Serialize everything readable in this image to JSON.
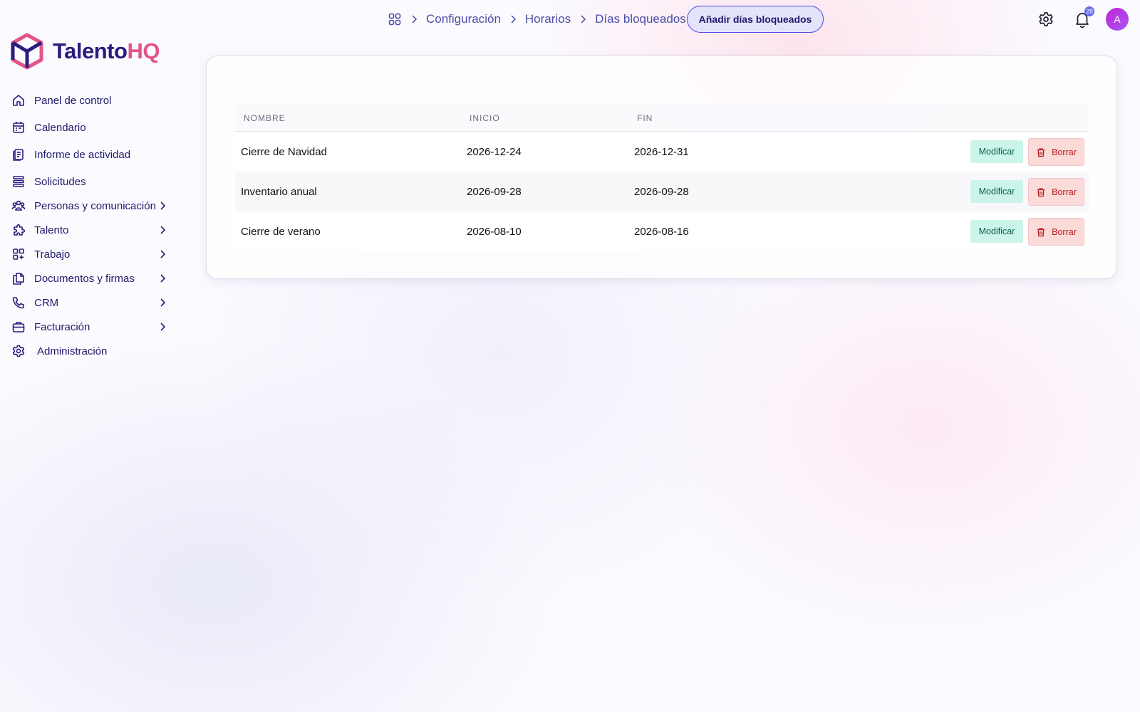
{
  "app": {
    "brand_part1": "Talento",
    "brand_part2": "HQ",
    "accent_color": "#4f46e5",
    "brand_pink": "#e2558a"
  },
  "sidebar": {
    "items": [
      {
        "label": "Panel de control",
        "icon": "home-icon",
        "has_submenu": false
      },
      {
        "label": "Calendario",
        "icon": "calendar-icon",
        "has_submenu": false
      },
      {
        "label": "Informe de actividad",
        "icon": "report-icon",
        "has_submenu": false
      },
      {
        "label": "Solicitudes",
        "icon": "stack-icon",
        "has_submenu": false
      },
      {
        "label": "Personas y comunicación",
        "icon": "users-icon",
        "has_submenu": true
      },
      {
        "label": "Talento",
        "icon": "puzzle-icon",
        "has_submenu": true
      },
      {
        "label": "Trabajo",
        "icon": "apps-icon",
        "has_submenu": true
      },
      {
        "label": "Documentos y firmas",
        "icon": "documents-icon",
        "has_submenu": true
      },
      {
        "label": "CRM",
        "icon": "phone-icon",
        "has_submenu": true
      },
      {
        "label": "Facturación",
        "icon": "briefcase-icon",
        "has_submenu": true
      },
      {
        "label": "Administración",
        "icon": "gear-icon",
        "has_submenu": false
      }
    ]
  },
  "breadcrumb": {
    "items": [
      "Configuración",
      "Horarios",
      "Días bloqueados"
    ]
  },
  "header": {
    "add_button_label": "Añadir días bloqueados",
    "notification_count": "28",
    "avatar_initial": "A"
  },
  "table": {
    "columns": [
      "NOMBRE",
      "INICIO",
      "FIN"
    ],
    "rows": [
      {
        "name": "Cierre de Navidad",
        "start": "2026-12-24",
        "end": "2026-12-31"
      },
      {
        "name": "Inventario anual",
        "start": "2026-09-28",
        "end": "2026-09-28"
      },
      {
        "name": "Cierre de verano",
        "start": "2026-08-10",
        "end": "2026-08-16"
      }
    ],
    "edit_label": "Modificar",
    "delete_label": "Borrar"
  }
}
